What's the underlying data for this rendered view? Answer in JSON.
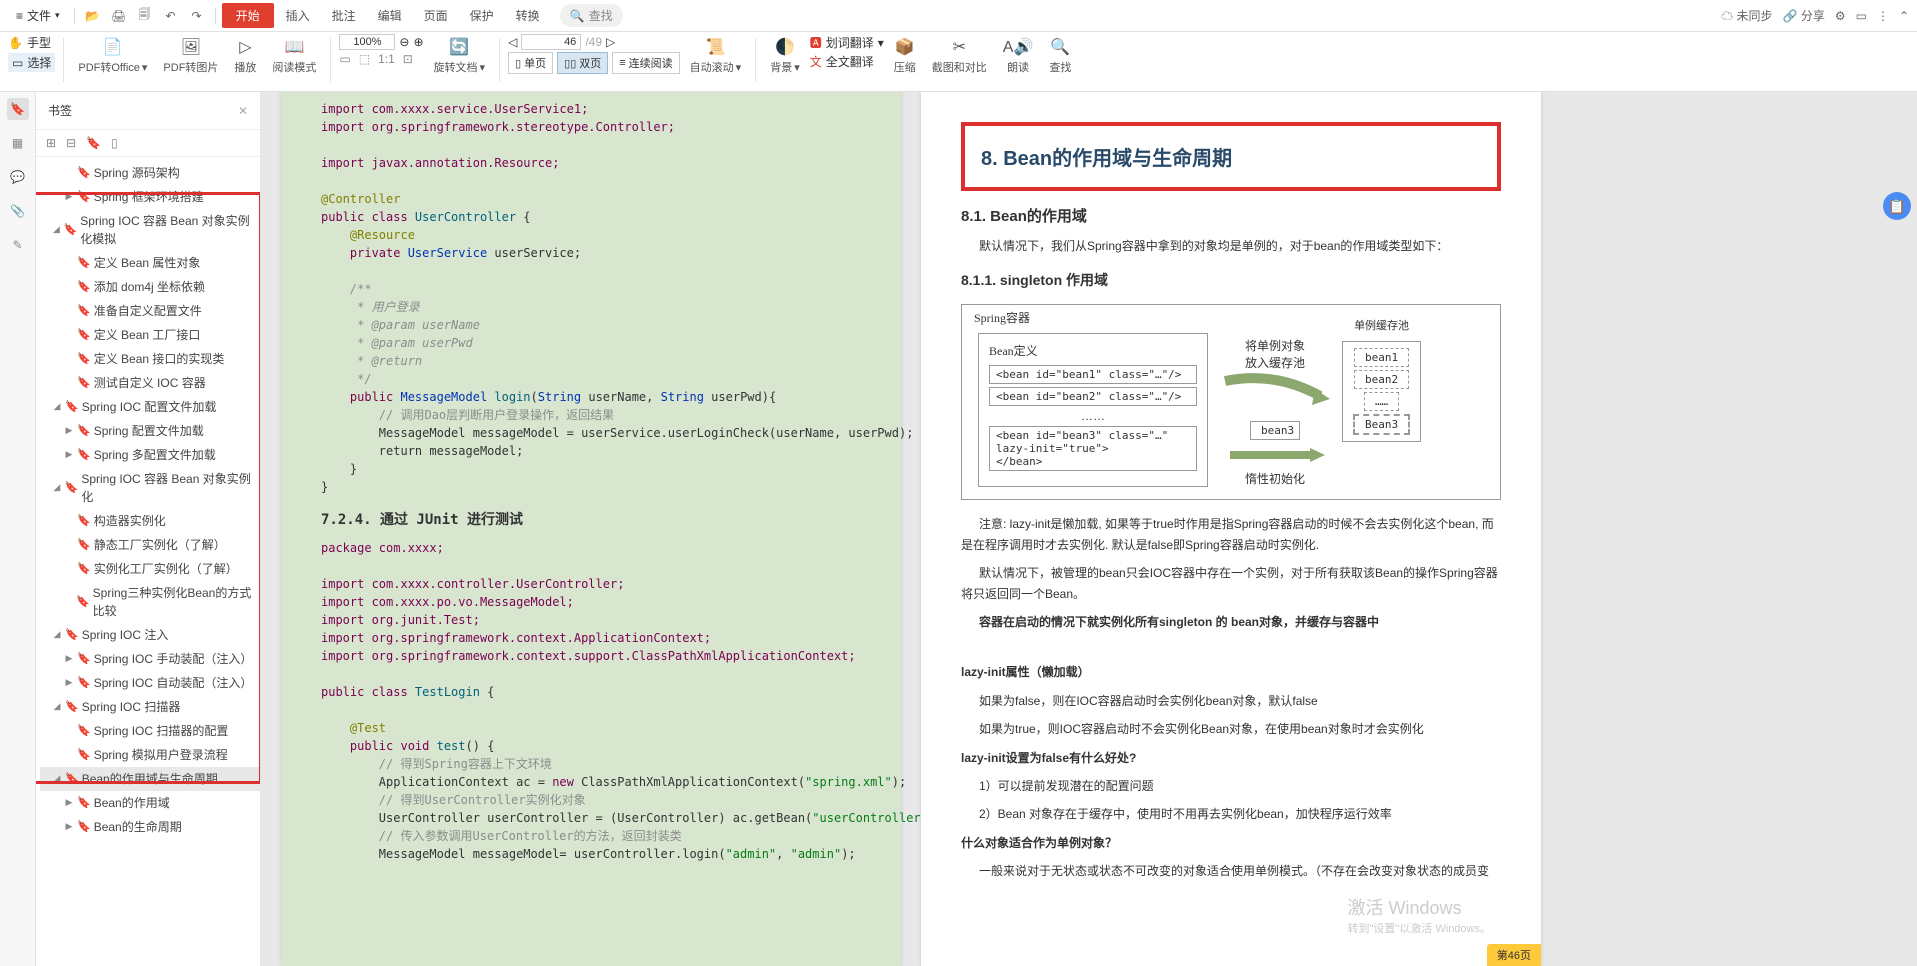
{
  "menubar": {
    "file": "文件",
    "tabs": {
      "start": "开始",
      "insert": "插入",
      "annotate": "批注",
      "edit": "编辑",
      "page": "页面",
      "protect": "保护",
      "convert": "转换"
    },
    "search": "查找",
    "right": {
      "unsync": "未同步",
      "share": "分享"
    }
  },
  "ribbon": {
    "hand": "手型",
    "select": "选择",
    "pdf2office": "PDF转Office",
    "pdf2img": "PDF转图片",
    "play": "播放",
    "readmode": "阅读模式",
    "zoom": "100%",
    "rotate": "旋转文档",
    "pagecur": "46",
    "pagetot": "/49",
    "single": "单页",
    "double": "双页",
    "continuous": "连续阅读",
    "autoscroll": "自动滚动",
    "bgcolor": "背景",
    "translate_sel": "划词翻译",
    "fulltrans": "全文翻译",
    "compress": "压缩",
    "compare": "截图和对比",
    "readaloud": "朗读",
    "find": "查找"
  },
  "bookmarks": {
    "title": "书签",
    "items": [
      {
        "lvl": 2,
        "tw": "",
        "text": "Spring 源码架构"
      },
      {
        "lvl": 2,
        "tw": "▶",
        "text": "Spring 框架环境搭建"
      },
      {
        "lvl": 1,
        "tw": "◢",
        "text": "Spring IOC 容器 Bean 对象实例化模拟"
      },
      {
        "lvl": 2,
        "tw": "",
        "text": "定义 Bean 属性对象"
      },
      {
        "lvl": 2,
        "tw": "",
        "text": "添加 dom4j 坐标依赖"
      },
      {
        "lvl": 2,
        "tw": "",
        "text": "准备自定义配置文件"
      },
      {
        "lvl": 2,
        "tw": "",
        "text": "定义 Bean 工厂接口"
      },
      {
        "lvl": 2,
        "tw": "",
        "text": "定义 Bean 接口的实现类"
      },
      {
        "lvl": 2,
        "tw": "",
        "text": "测试自定义 IOC 容器"
      },
      {
        "lvl": 1,
        "tw": "◢",
        "text": "Spring IOC 配置文件加载"
      },
      {
        "lvl": 2,
        "tw": "▶",
        "text": "Spring  配置文件加载"
      },
      {
        "lvl": 2,
        "tw": "▶",
        "text": "Spring  多配置文件加载"
      },
      {
        "lvl": 1,
        "tw": "◢",
        "text": "Spring IOC 容器 Bean 对象实例化"
      },
      {
        "lvl": 2,
        "tw": "",
        "text": "构造器实例化"
      },
      {
        "lvl": 2,
        "tw": "",
        "text": "静态工厂实例化（了解）"
      },
      {
        "lvl": 2,
        "tw": "",
        "text": "实例化工厂实例化（了解）"
      },
      {
        "lvl": 2,
        "tw": "",
        "text": "Spring三种实例化Bean的方式比较"
      },
      {
        "lvl": 1,
        "tw": "◢",
        "text": "Spring IOC 注入"
      },
      {
        "lvl": 2,
        "tw": "▶",
        "text": "Spring IOC 手动装配（注入）"
      },
      {
        "lvl": 2,
        "tw": "▶",
        "text": "Spring IOC 自动装配（注入）"
      },
      {
        "lvl": 1,
        "tw": "◢",
        "text": "Spring IOC 扫描器"
      },
      {
        "lvl": 2,
        "tw": "",
        "text": "Spring IOC 扫描器的配置"
      },
      {
        "lvl": 2,
        "tw": "",
        "text": "Spring 模拟用户登录流程"
      },
      {
        "lvl": 1,
        "tw": "◢",
        "text": "Bean的作用域与生命周期",
        "selected": true
      },
      {
        "lvl": 2,
        "tw": "▶",
        "text": "Bean的作用域"
      },
      {
        "lvl": 2,
        "tw": "▶",
        "text": "Bean的生命周期"
      }
    ]
  },
  "page1": {
    "code_pre": "import com.xxxx.service.UserService1;\nimport org.springframework.stereotype.Controller;\n\nimport javax.annotation.Resource;\n",
    "anno1": "@Controller",
    "cls_decl_pub": "public class ",
    "cls_decl_name": "UserController ",
    "cls_brace": "{",
    "anno2": "    @Resource",
    "f_priv": "    private ",
    "f_type": "UserService ",
    "f_name": "userService",
    "f_end": ";",
    "doc1": "    /**",
    "doc2": "     * 用户登录",
    "doc3": "     * @param userName",
    "doc4": "     * @param userPwd",
    "doc5": "     * @return",
    "doc6": "     */",
    "m1_pub": "    public ",
    "m1_ret": "MessageModel ",
    "m1_name": "login",
    "m1_p1": "(",
    "m1_t1": "String ",
    "m1_a1": "userName, ",
    "m1_t2": "String ",
    "m1_a2": "userPwd){",
    "cmt1": "        // 调用Dao层判断用户登录操作，返回结果",
    "m1_b1": "        MessageModel messageModel = userService.userLoginCheck(userName, userPwd);",
    "m1_b2": "        return messageModel;",
    "m1_b3": "    }",
    "m1_b4": "}",
    "sec": "7.2.4. 通过 JUnit 进行测试",
    "pkg": "package com.xxxx;",
    "imp1": "import com.xxxx.controller.UserController;",
    "imp2": "import com.xxxx.po.vo.MessageModel;",
    "imp3": "import org.junit.Test;",
    "imp4": "import org.springframework.context.ApplicationContext;",
    "imp5": "import org.springframework.context.support.ClassPathXmlApplicationContext;",
    "cls2_pub": "public class ",
    "cls2_name": "TestLogin ",
    "cls2_brace": "{",
    "anno3": "    @Test",
    "m2_pub": "    public ",
    "m2_void": "void ",
    "m2_name": "test",
    "m2_p": "() {",
    "cmt2": "        // 得到Spring容器上下文环境",
    "m2_l1a": "        ApplicationContext ac = ",
    "m2_l1b": "new ",
    "m2_l1c": "ClassPathXmlApplicationContext(",
    "m2_l1d": "\"spring.xml\"",
    "m2_l1e": ");",
    "cmt3": "        // 得到UserController实例化对象",
    "m2_l2a": "        UserController userController = (UserController) ac.getBean(",
    "m2_l2b": "\"userController\"",
    "m2_l2c": ");",
    "cmt4": "        // 传入参数调用UserController的方法，返回封装类",
    "m2_l3a": "        MessageModel messageModel= userController.login(",
    "m2_l3b": "\"admin\"",
    "m2_l3c": ", ",
    "m2_l3d": "\"admin\"",
    "m2_l3e": ");"
  },
  "page2": {
    "h8": "8. Bean的作用域与生命周期",
    "h81": "8.1. Bean的作用域",
    "p1": "默认情况下，我们从Spring容器中拿到的对象均是单例的，对于bean的作用域类型如下：",
    "h811": "8.1.1. singleton 作用域",
    "diag": {
      "container": "Spring容器",
      "beandef": "Bean定义",
      "b1": "<bean id=\"bean1\" class=\"…\"/>",
      "b2": "<bean id=\"bean2\" class=\"…\"/>",
      "dots": "……",
      "b3a": "<bean id=\"bean3\" class=\"…\"",
      "b3b": "        lazy-init=\"true\">",
      "b3c": "</bean>",
      "txt1": "将单例对象",
      "txt2": "放入缓存池",
      "box_bean3": "bean3",
      "txt3": "惰性初始化",
      "pool_title": "单例缓存池",
      "s1": "bean1",
      "s2": "bean2",
      "s3": "……",
      "s4": "Bean3"
    },
    "note": "注意: lazy-init是懒加载, 如果等于true时作用是指Spring容器启动的时候不会去实例化这个bean, 而是在程序调用时才去实例化. 默认是false即Spring容器启动时实例化.",
    "p2": "默认情况下，被管理的bean只会IOC容器中存在一个实例，对于所有获取该Bean的操作Spring容器将只返回同一个Bean。",
    "p3": "容器在启动的情况下就实例化所有singleton 的 bean对象，并缓存与容器中",
    "h_lazyattr": "lazy-init属性（懒加载）",
    "p4": "如果为false，则在IOC容器启动时会实例化bean对象，默认false",
    "p5": "如果为true，则IOC容器启动时不会实例化Bean对象，在使用bean对象时才会实例化",
    "h_lazyfalse": "lazy-init设置为false有什么好处?",
    "p6": "1）可以提前发现潜在的配置问题",
    "p7": "2）Bean 对象存在于缓存中，使用时不用再去实例化bean，加快程序运行效率",
    "h_suitable": "什么对象适合作为单例对象？",
    "p8": "一般来说对于无状态或状态不可改变的对象适合使用单例模式。（不存在会改变对象状态的成员变",
    "watermark": "激活 Windows",
    "watermark_sub": "转到\"设置\"以激活 Windows。",
    "pagebadge": "第46页"
  }
}
